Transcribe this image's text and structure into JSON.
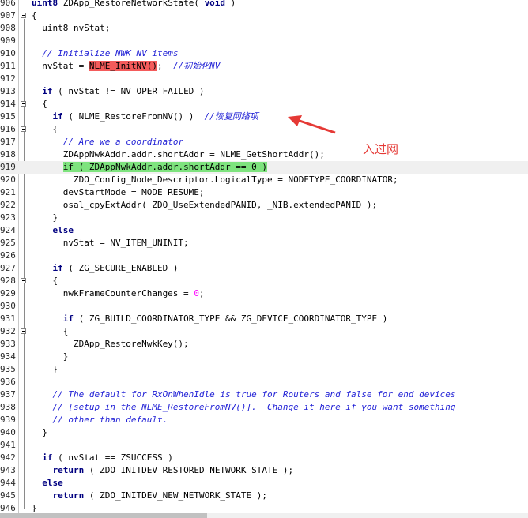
{
  "lines": [
    {
      "num": "906",
      "fold": false,
      "segs": [
        [
          "kw",
          "uint8 "
        ],
        [
          "",
          "ZDApp_RestoreNetworkState( "
        ],
        [
          "kw",
          "void"
        ],
        [
          "",
          " )"
        ]
      ]
    },
    {
      "num": "907",
      "fold": true,
      "segs": [
        [
          "",
          "{"
        ]
      ]
    },
    {
      "num": "908",
      "fold": false,
      "segs": [
        [
          "",
          "  uint8 nvStat;"
        ]
      ]
    },
    {
      "num": "909",
      "fold": false,
      "segs": []
    },
    {
      "num": "910",
      "fold": false,
      "segs": [
        [
          "",
          "  "
        ],
        [
          "cm",
          "// Initialize NWK NV items"
        ]
      ]
    },
    {
      "num": "911",
      "fold": false,
      "segs": [
        [
          "",
          "  nvStat = "
        ],
        [
          "hl-red",
          "NLME_InitNV()"
        ],
        [
          "",
          ";  "
        ],
        [
          "cm",
          "//初始化NV"
        ]
      ]
    },
    {
      "num": "912",
      "fold": false,
      "segs": []
    },
    {
      "num": "913",
      "fold": false,
      "segs": [
        [
          "",
          "  "
        ],
        [
          "kw",
          "if"
        ],
        [
          "",
          " ( nvStat != NV_OPER_FAILED )"
        ]
      ]
    },
    {
      "num": "914",
      "fold": true,
      "segs": [
        [
          "",
          "  {"
        ]
      ]
    },
    {
      "num": "915",
      "fold": false,
      "segs": [
        [
          "",
          "    "
        ],
        [
          "kw",
          "if"
        ],
        [
          "",
          " ( NLME_RestoreFromNV() )  "
        ],
        [
          "cm",
          "//恢复网络项"
        ]
      ]
    },
    {
      "num": "916",
      "fold": true,
      "segs": [
        [
          "",
          "    {"
        ]
      ]
    },
    {
      "num": "917",
      "fold": false,
      "segs": [
        [
          "",
          "      "
        ],
        [
          "cm",
          "// Are we a coordinator"
        ]
      ]
    },
    {
      "num": "918",
      "fold": false,
      "segs": [
        [
          "",
          "      ZDAppNwkAddr.addr.shortAddr = NLME_GetShortAddr();"
        ]
      ]
    },
    {
      "num": "919",
      "fold": false,
      "highlight": true,
      "segs": [
        [
          "",
          "      "
        ],
        [
          "hl-green",
          "if ( ZDAppNwkAddr.addr.shortAddr == 0 )"
        ]
      ]
    },
    {
      "num": "920",
      "fold": false,
      "segs": [
        [
          "",
          "        ZDO_Config_Node_Descriptor.LogicalType = NODETYPE_COORDINATOR;"
        ]
      ]
    },
    {
      "num": "921",
      "fold": false,
      "segs": [
        [
          "",
          "      devStartMode = MODE_RESUME;"
        ]
      ]
    },
    {
      "num": "922",
      "fold": false,
      "segs": [
        [
          "",
          "      osal_cpyExtAddr( ZDO_UseExtendedPANID, _NIB.extendedPANID );"
        ]
      ]
    },
    {
      "num": "923",
      "fold": false,
      "segs": [
        [
          "",
          "    }"
        ]
      ]
    },
    {
      "num": "924",
      "fold": false,
      "segs": [
        [
          "",
          "    "
        ],
        [
          "kw",
          "else"
        ]
      ]
    },
    {
      "num": "925",
      "fold": false,
      "segs": [
        [
          "",
          "      nvStat = NV_ITEM_UNINIT;"
        ]
      ]
    },
    {
      "num": "926",
      "fold": false,
      "segs": []
    },
    {
      "num": "927",
      "fold": false,
      "segs": [
        [
          "",
          "    "
        ],
        [
          "kw",
          "if"
        ],
        [
          "",
          " ( ZG_SECURE_ENABLED )"
        ]
      ]
    },
    {
      "num": "928",
      "fold": true,
      "segs": [
        [
          "",
          "    {"
        ]
      ]
    },
    {
      "num": "929",
      "fold": false,
      "segs": [
        [
          "",
          "      nwkFrameCounterChanges = "
        ],
        [
          "num",
          "0"
        ],
        [
          "",
          ";"
        ]
      ]
    },
    {
      "num": "930",
      "fold": false,
      "segs": []
    },
    {
      "num": "931",
      "fold": false,
      "segs": [
        [
          "",
          "      "
        ],
        [
          "kw",
          "if"
        ],
        [
          "",
          " ( ZG_BUILD_COORDINATOR_TYPE && ZG_DEVICE_COORDINATOR_TYPE )"
        ]
      ]
    },
    {
      "num": "932",
      "fold": true,
      "segs": [
        [
          "",
          "      {"
        ]
      ]
    },
    {
      "num": "933",
      "fold": false,
      "segs": [
        [
          "",
          "        ZDApp_RestoreNwkKey();"
        ]
      ]
    },
    {
      "num": "934",
      "fold": false,
      "segs": [
        [
          "",
          "      }"
        ]
      ]
    },
    {
      "num": "935",
      "fold": false,
      "segs": [
        [
          "",
          "    }"
        ]
      ]
    },
    {
      "num": "936",
      "fold": false,
      "segs": []
    },
    {
      "num": "937",
      "fold": false,
      "segs": [
        [
          "",
          "    "
        ],
        [
          "cm",
          "// The default for RxOnWhenIdle is true for Routers and false for end devices"
        ]
      ]
    },
    {
      "num": "938",
      "fold": false,
      "segs": [
        [
          "",
          "    "
        ],
        [
          "cm",
          "// [setup in the NLME_RestoreFromNV()].  Change it here if you want something"
        ]
      ]
    },
    {
      "num": "939",
      "fold": false,
      "segs": [
        [
          "",
          "    "
        ],
        [
          "cm",
          "// other than default."
        ]
      ]
    },
    {
      "num": "940",
      "fold": false,
      "segs": [
        [
          "",
          "  }"
        ]
      ]
    },
    {
      "num": "941",
      "fold": false,
      "segs": []
    },
    {
      "num": "942",
      "fold": false,
      "segs": [
        [
          "",
          "  "
        ],
        [
          "kw",
          "if"
        ],
        [
          "",
          " ( nvStat == ZSUCCESS )"
        ]
      ]
    },
    {
      "num": "943",
      "fold": false,
      "segs": [
        [
          "",
          "    "
        ],
        [
          "kw",
          "return"
        ],
        [
          "",
          " ( ZDO_INITDEV_RESTORED_NETWORK_STATE );"
        ]
      ]
    },
    {
      "num": "944",
      "fold": false,
      "segs": [
        [
          "",
          "  "
        ],
        [
          "kw",
          "else"
        ]
      ]
    },
    {
      "num": "945",
      "fold": false,
      "segs": [
        [
          "",
          "    "
        ],
        [
          "kw",
          "return"
        ],
        [
          "",
          " ( ZDO_INITDEV_NEW_NETWORK_STATE );"
        ]
      ]
    },
    {
      "num": "946",
      "fold": false,
      "segs": [
        [
          "",
          "}"
        ]
      ]
    }
  ],
  "annotation": {
    "text": "入过网",
    "color": "#e53935"
  },
  "colors": {
    "keyword": "#000080",
    "comment": "#2323d6",
    "number": "#ff00ff",
    "highlight_red": "#f45b5b",
    "highlight_green": "#7ee37e"
  },
  "icons": {
    "fold": "fold-minus-icon",
    "arrow": "red-arrow-icon"
  }
}
